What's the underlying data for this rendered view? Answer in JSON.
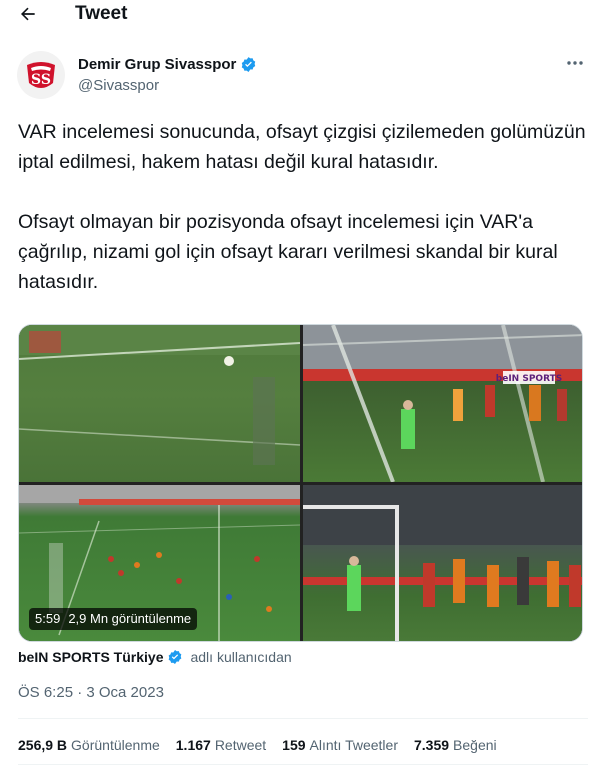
{
  "header": {
    "title": "Tweet",
    "back_icon": "arrow-left-icon"
  },
  "author": {
    "name": "Demir Grup Sivasspor",
    "handle": "@Sivasspor",
    "verified_icon": "verified-badge-icon",
    "avatar_icon": "sivasspor-logo",
    "accent_color": "#d0122c"
  },
  "tweet": {
    "paragraphs": [
      "VAR incelemesi sonucunda, ofsayt çizgisi çizilemeden golümüzün iptal edilmesi, hakem hatası değil kural hatasıdır.",
      "Ofsayt olmayan bir pozisyonda ofsayt incelemesi için VAR'a çağrılıp, nizami gol için ofsayt kararı verilmesi skandal bir kural hatasıdır."
    ]
  },
  "media": {
    "duration": "5:59",
    "views": "2,9 Mn görüntülenme",
    "broadcaster_logo": "beIN SPORTS"
  },
  "attribution": {
    "owner": "beIN SPORTS Türkiye",
    "suffix": "adlı kullanıcıdan"
  },
  "timestamp": "ÖS 6:25 · 3 Oca 2023",
  "stats": [
    {
      "num": "256,9 B",
      "label": "Görüntülenme"
    },
    {
      "num": "1.167",
      "label": "Retweet"
    },
    {
      "num": "159",
      "label": "Alıntı Tweetler"
    },
    {
      "num": "7.359",
      "label": "Beğeni"
    }
  ],
  "colors": {
    "verified": "#1d9bf0",
    "secondary_text": "#536471"
  }
}
